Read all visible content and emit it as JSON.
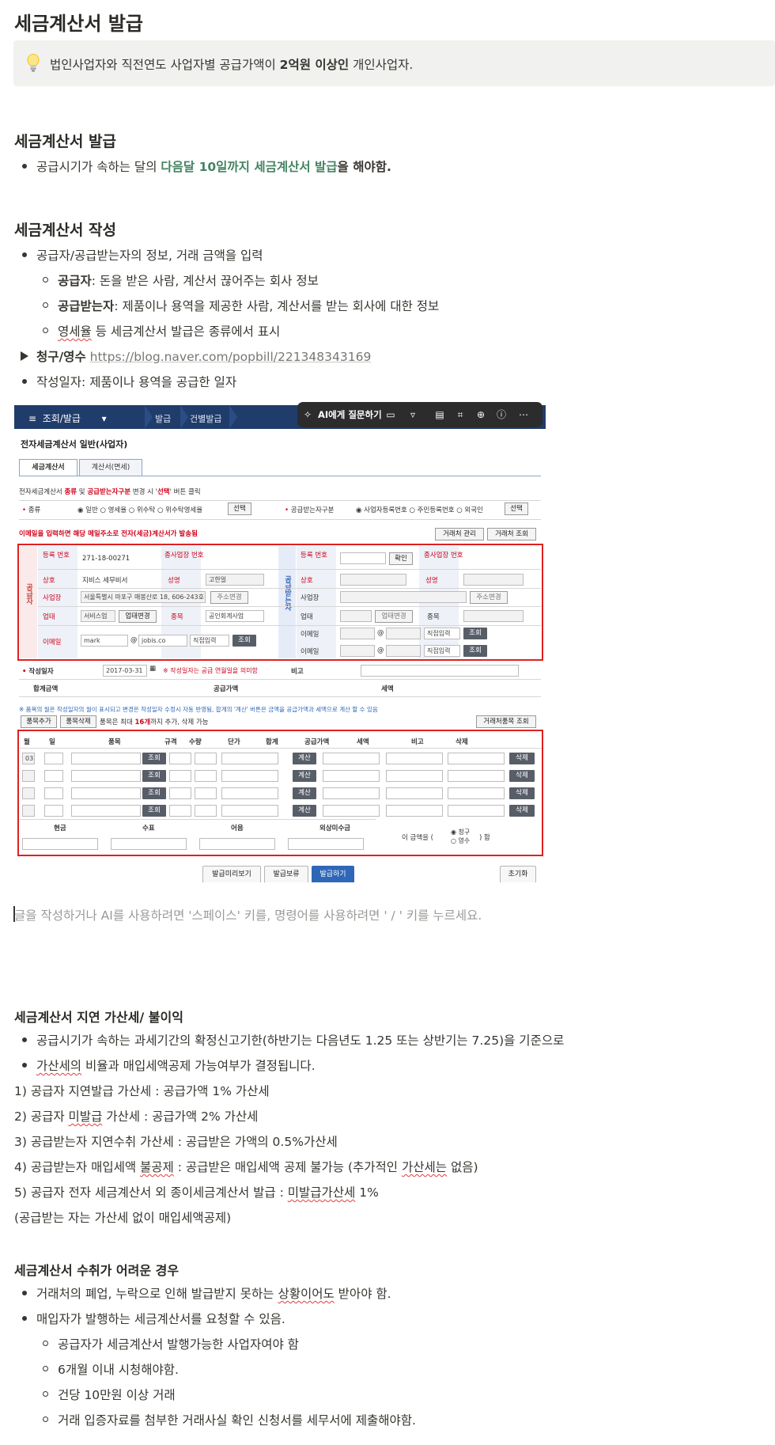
{
  "page": {
    "title": "세금계산서 발급",
    "callout": {
      "icon": "lightbulb-icon",
      "text_before": "법인사업자와 직전연도 사업자별 공급가액이 ",
      "text_bold": "2억원 이상인",
      "text_after": " 개인사업자."
    },
    "section_issue": {
      "heading": "세금계산서 발급",
      "bullet_before": "공급시기가 속하는 달의 ",
      "bullet_green": "다음달 10일까지 세금계산서 발급",
      "bullet_after": "을 해야함."
    },
    "section_write": {
      "heading": "세금계산서 작성",
      "bullet1": "공급자/공급받는자의 정보, 거래 금액을 입력",
      "sub1_bold": "공급자",
      "sub1_rest": ": 돈을 받은 사람, 계산서 끊어주는 회사 정보",
      "sub2_bold": "공급받는자",
      "sub2_rest": ": 제품이나 용역을 제공한 사람, 계산서를 받는 회사에 대한 정보",
      "sub3_squig": "영세율",
      "sub3_rest": " 등 세금계산서 발급은 종류에서 표시",
      "toggle_bold": "청구/영수",
      "toggle_link": "https://blog.naver.com/popbill/221348343169",
      "bullet_date": "작성일자: 제품이나 용역을 공급한 일자"
    },
    "placeholder": "글을 작성하거나 AI를 사용하려면 '스페이스' 키를, 명령어를 사용하려면 ' / ' 키를 누르세요.",
    "section_penalty": {
      "heading": "세금계산서 지연 가산세/ 불이익",
      "b1": "공급시기가 속하는 과세기간의 확정신고기한(하반기는 다음년도 1.25 또는 상반기는 7.25)을 기준으로",
      "b2_squig": "가산세의",
      "b2_rest": " 비율과 매입세액공제 가능여부가 결정됩니다.",
      "p1": "1) 공급자 지연발급 가산세 : 공급가액 1% 가산세",
      "p2_a": "2) 공급자 ",
      "p2_squig": "미발급",
      "p2_b": " 가산세 : 공급가액 2% 가산세",
      "p3": "3) 공급받는자 지연수취 가산세 : 공급받은 가액의 0.5%가산세",
      "p4_a": "4) 공급받는자 매입세액 ",
      "p4_squig": "불공제",
      "p4_b": " : 공급받은 매입세액 공제 불가능 (추가적인 ",
      "p4_squig2": "가산세는",
      "p4_c": " 없음)",
      "p5_a": "5) 공급자 전자 세금계산서 외 종이세금계산서 발급 : ",
      "p5_squig": "미발급가산세",
      "p5_b": " 1%",
      "p6": "(공급받는 자는 가산세 없이 매입세액공제)"
    },
    "section_hard": {
      "heading": "세금계산서 수취가 어려운 경우",
      "b1_a": "거래처의 폐업, 누락으로 인해 발급받지 못하는 ",
      "b1_squig": "상황이어도",
      "b1_b": " 받아야 함.",
      "b2": "매입자가 발행하는 세금계산서를 요청할 수 있음.",
      "s1": "공급자가 세금계산서 발행가능한 사업자여야 함",
      "s2": "6개월 이내 시청해야함.",
      "s3": "건당 10만원 이상 거래",
      "s4": "거래 입증자료를 첨부한 거래사실 확인 신청서를 세무서에 제출해야함."
    }
  },
  "screenshot": {
    "menu": "조회/발급",
    "crumb1": "발급",
    "crumb2": "건별발급",
    "ai_label": "AI에게 질문하기",
    "form_title": "전자세금계산서 일반(사업자)",
    "tab1": "세금계산서",
    "tab2": "계산서(면세)",
    "note_top_a": "전자세금계산서 ",
    "note_top_red1": "종류",
    "note_top_b": " 및 ",
    "note_top_red2": "공급받는자구분",
    "note_top_c": " 변경 시 '",
    "note_top_red3": "선택",
    "note_top_d": "' 버튼 클릭",
    "kind_label": "종류",
    "kind_opts": "◉ 일반  ○ 영세율  ○ 위수탁  ○ 위수탁영세율",
    "select_btn": "선택",
    "recv_kind_label": "공급받는자구분",
    "recv_kind_opts": "◉ 사업자등록번호  ○ 주민등록번호  ○ 외국인",
    "email_notice": "이메일을 입력하면 해당 메일주소로 전자(세금)계산서가 발송됨",
    "btn_partner_mgmt": "거래처 관리",
    "btn_partner_search": "거래처 조회",
    "supplier_vt": "공급자",
    "receiver_vt": "공급받는자",
    "reg_no_label": "등록 번호",
    "reg_no_value": "271-18-00271",
    "branch_label": "종사업장 번호",
    "name_label": "상호",
    "name_value": "지비스 세무비서",
    "ceo_label": "성명",
    "ceo_value": "고한얼",
    "addr_label": "사업장",
    "addr_value": "서울특별시 마포구 매봉산로 18, 606-243호",
    "addr_btn": "주소변경",
    "biz_label": "업태",
    "biz_value": "서비스업",
    "biz_btn": "업태변경",
    "item_label": "종목",
    "item_value": "공인회계사업",
    "email_label": "이메일",
    "email_id": "mark",
    "email_domain": "jobis.co",
    "email_select": "직접입력",
    "search_btn": "조회",
    "confirm_btn": "확인",
    "date_label": "작성일자",
    "date_value": "2017-03-31",
    "date_note": "※ 작성일자는 공급 연월일을 의미함",
    "memo_label": "비고",
    "total_label": "합계금액",
    "supply_label": "공급가액",
    "tax_label": "세액",
    "items_note": "※ 품목의 월은 작성일자의 월이 표시되고 변경은 작성일자 수정시 자동 반영됨, 합계의 '계산' 버튼은 금액을 공급가액과 세액으로 계산 할 수 있음",
    "btn_add_item": "품목추가",
    "btn_del_item": "품목삭제",
    "items_max_a": "품목은 최대 ",
    "items_max_b": "16개",
    "items_max_c": "까지 추가, 삭제 가능",
    "btn_partner_item": "거래처품목 조회",
    "cols": [
      "월",
      "일",
      "품목",
      "규격",
      "수량",
      "단가",
      "합계",
      "공급가액",
      "세액",
      "비고",
      "삭제"
    ],
    "row_month": "03",
    "calc_btn": "계산",
    "del_btn": "삭제",
    "pay_cols": [
      "현금",
      "수표",
      "어음",
      "외상미수금"
    ],
    "amount_a": "이 금액을 (",
    "amount_opt1": "◉ 청구",
    "amount_opt2": "○ 영수",
    "amount_b": ") 함",
    "btn_preview": "발급미리보기",
    "btn_hold": "발급보류",
    "btn_issue": "발급하기",
    "btn_reset": "초기화"
  }
}
